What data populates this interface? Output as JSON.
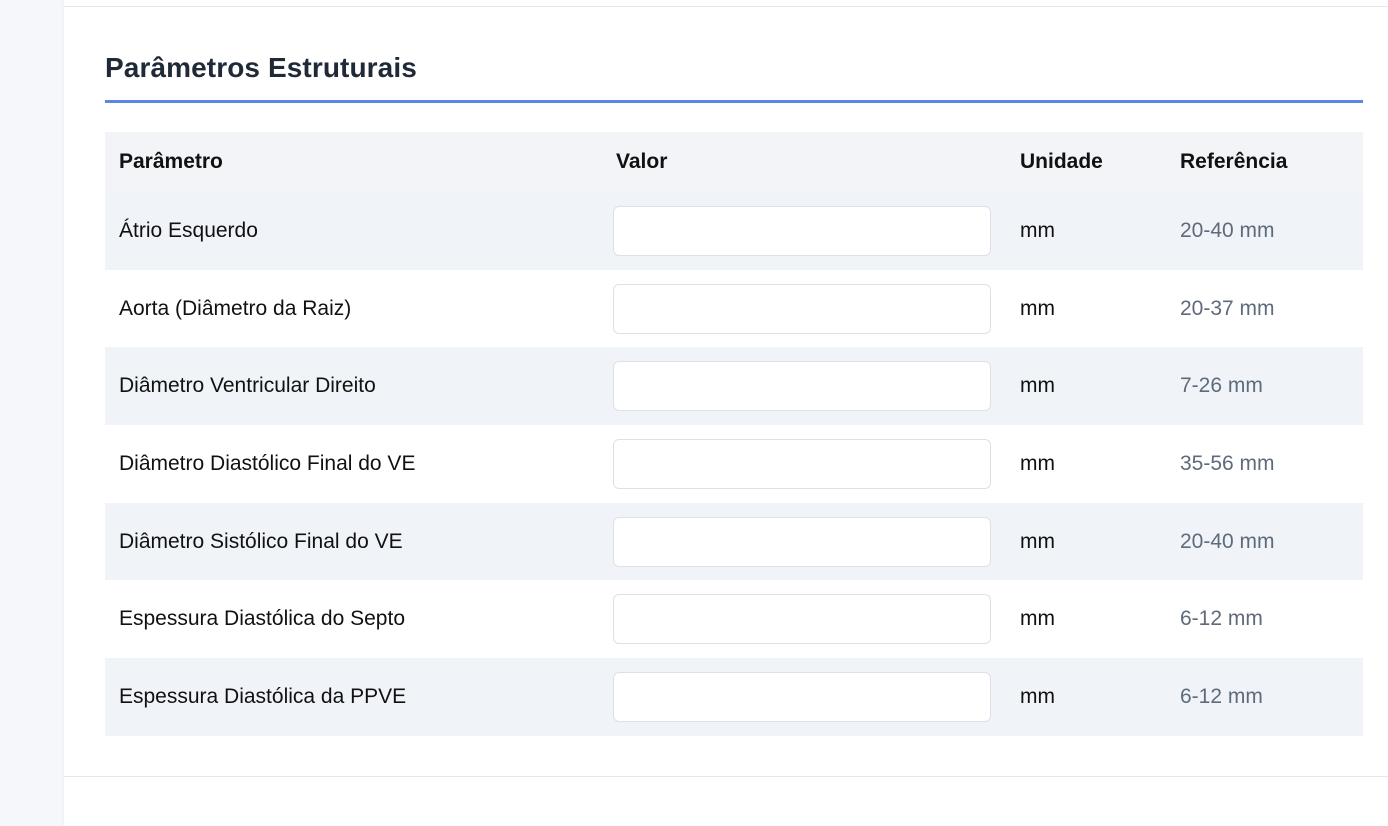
{
  "section": {
    "title": "Parâmetros Estruturais"
  },
  "table": {
    "headers": {
      "parametro": "Parâmetro",
      "valor": "Valor",
      "unidade": "Unidade",
      "referencia": "Referência"
    },
    "rows": [
      {
        "parametro": "Átrio Esquerdo",
        "valor": "",
        "unidade": "mm",
        "referencia": "20-40 mm"
      },
      {
        "parametro": "Aorta (Diâmetro da Raiz)",
        "valor": "",
        "unidade": "mm",
        "referencia": "20-37 mm"
      },
      {
        "parametro": "Diâmetro Ventricular Direito",
        "valor": "",
        "unidade": "mm",
        "referencia": "7-26 mm"
      },
      {
        "parametro": "Diâmetro Diastólico Final do VE",
        "valor": "",
        "unidade": "mm",
        "referencia": "35-56 mm"
      },
      {
        "parametro": "Diâmetro Sistólico Final do VE",
        "valor": "",
        "unidade": "mm",
        "referencia": "20-40 mm"
      },
      {
        "parametro": "Espessura Diastólica do Septo",
        "valor": "",
        "unidade": "mm",
        "referencia": "6-12 mm"
      },
      {
        "parametro": "Espessura Diastólica da PPVE",
        "valor": "",
        "unidade": "mm",
        "referencia": "6-12 mm"
      }
    ]
  },
  "colors": {
    "accent": "#5b86e5",
    "header_bg": "#f2f4f7",
    "stripe_bg": "#f0f4f8",
    "reference_text": "#5f6b7a"
  }
}
